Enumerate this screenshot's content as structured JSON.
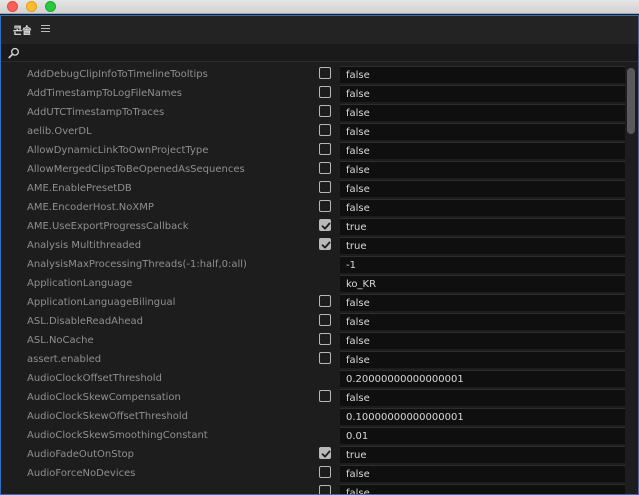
{
  "window": {
    "close_icon": "close-traffic-light",
    "minimize_icon": "minimize-traffic-light",
    "zoom_icon": "zoom-traffic-light"
  },
  "panel": {
    "tab_label": "콘솔",
    "menu_icon": "hamburger-menu-icon"
  },
  "search": {
    "icon": "search-icon",
    "value": ""
  },
  "rows": [
    {
      "label": "AddDebugClipInfoToTimelineTooltips",
      "checkbox": true,
      "checked": false,
      "value": "false"
    },
    {
      "label": "AddTimestampToLogFileNames",
      "checkbox": true,
      "checked": false,
      "value": "false"
    },
    {
      "label": "AddUTCTimestampToTraces",
      "checkbox": true,
      "checked": false,
      "value": "false"
    },
    {
      "label": "aelib.OverDL",
      "checkbox": true,
      "checked": false,
      "value": "false"
    },
    {
      "label": "AllowDynamicLinkToOwnProjectType",
      "checkbox": true,
      "checked": false,
      "value": "false"
    },
    {
      "label": "AllowMergedClipsToBeOpenedAsSequences",
      "checkbox": true,
      "checked": false,
      "value": "false"
    },
    {
      "label": "AME.EnablePresetDB",
      "checkbox": true,
      "checked": false,
      "value": "false"
    },
    {
      "label": "AME.EncoderHost.NoXMP",
      "checkbox": true,
      "checked": false,
      "value": "false"
    },
    {
      "label": "AME.UseExportProgressCallback",
      "checkbox": true,
      "checked": true,
      "value": "true"
    },
    {
      "label": "Analysis Multithreaded",
      "checkbox": true,
      "checked": true,
      "value": "true"
    },
    {
      "label": "AnalysisMaxProcessingThreads(-1:half,0:all)",
      "checkbox": false,
      "checked": false,
      "value": "-1"
    },
    {
      "label": "ApplicationLanguage",
      "checkbox": false,
      "checked": false,
      "value": "ko_KR"
    },
    {
      "label": "ApplicationLanguageBilingual",
      "checkbox": true,
      "checked": false,
      "value": "false"
    },
    {
      "label": "ASL.DisableReadAhead",
      "checkbox": true,
      "checked": false,
      "value": "false"
    },
    {
      "label": "ASL.NoCache",
      "checkbox": true,
      "checked": false,
      "value": "false"
    },
    {
      "label": "assert.enabled",
      "checkbox": true,
      "checked": false,
      "value": "false"
    },
    {
      "label": "AudioClockOffsetThreshold",
      "checkbox": false,
      "checked": false,
      "value": "0.20000000000000001"
    },
    {
      "label": "AudioClockSkewCompensation",
      "checkbox": true,
      "checked": false,
      "value": "false"
    },
    {
      "label": "AudioClockSkewOffsetThreshold",
      "checkbox": false,
      "checked": false,
      "value": "0.10000000000000001"
    },
    {
      "label": "AudioClockSkewSmoothingConstant",
      "checkbox": false,
      "checked": false,
      "value": "0.01"
    },
    {
      "label": "AudioFadeOutOnStop",
      "checkbox": true,
      "checked": true,
      "value": "true"
    },
    {
      "label": "AudioForceNoDevices",
      "checkbox": true,
      "checked": false,
      "value": "false"
    },
    {
      "label": "",
      "checkbox": true,
      "checked": false,
      "value": "false"
    }
  ]
}
